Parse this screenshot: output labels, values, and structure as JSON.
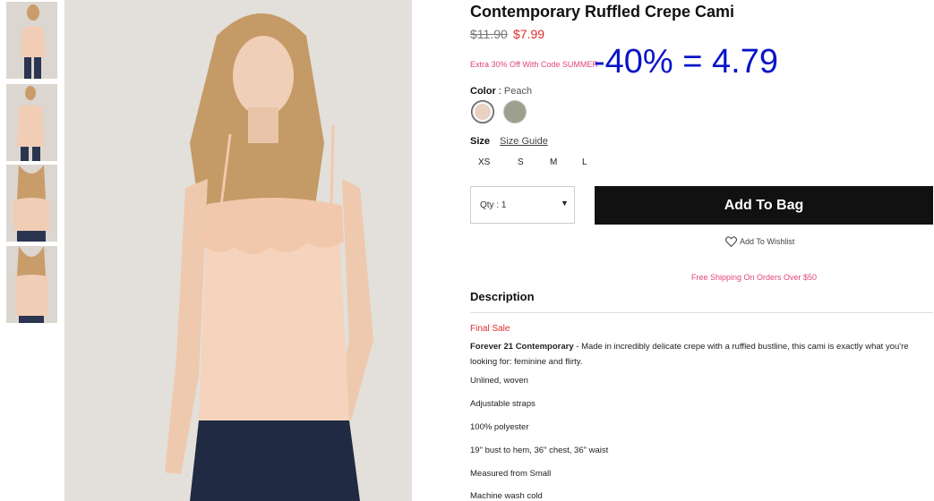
{
  "product": {
    "title": "Contemporary Ruffled Crepe Cami",
    "price_old": "$11.90",
    "price_new": "$7.99",
    "promo": "Extra 30% Off With Code SUMMER",
    "annotation": "-40% = 4.79"
  },
  "color": {
    "label": "Color",
    "separator": " : ",
    "selected": "Peach",
    "swatches": [
      {
        "name": "Peach",
        "hex": "#e9d1c4"
      },
      {
        "name": "Sage",
        "hex": "#9ea08e"
      }
    ]
  },
  "size": {
    "label": "Size",
    "guide_label": "Size Guide",
    "options": [
      "XS",
      "S",
      "M",
      "L"
    ]
  },
  "qty": {
    "label": "Qty : 1",
    "caret": "▼"
  },
  "actions": {
    "add_to_bag": "Add To Bag",
    "wishlist": "Add To Wishlist"
  },
  "shipping": "Free Shipping On Orders Over $50",
  "description": {
    "heading": "Description",
    "final_sale": "Final Sale",
    "brand": "Forever 21 Contemporary",
    "body": " - Made in incredibly delicate crepe with a ruffled bustline, this cami is exactly what you're looking for: feminine and flirty.",
    "details": [
      "Unlined, woven",
      "Adjustable straps",
      "100% polyester",
      "19\" bust to hem, 36\" chest, 36\" waist",
      "Measured from Small",
      "Machine wash cold"
    ]
  },
  "colors": {
    "accent_red": "#e02b2b",
    "accent_pink": "#e0457b",
    "annotation_blue": "#0a14c8",
    "button_bg": "#111111"
  }
}
